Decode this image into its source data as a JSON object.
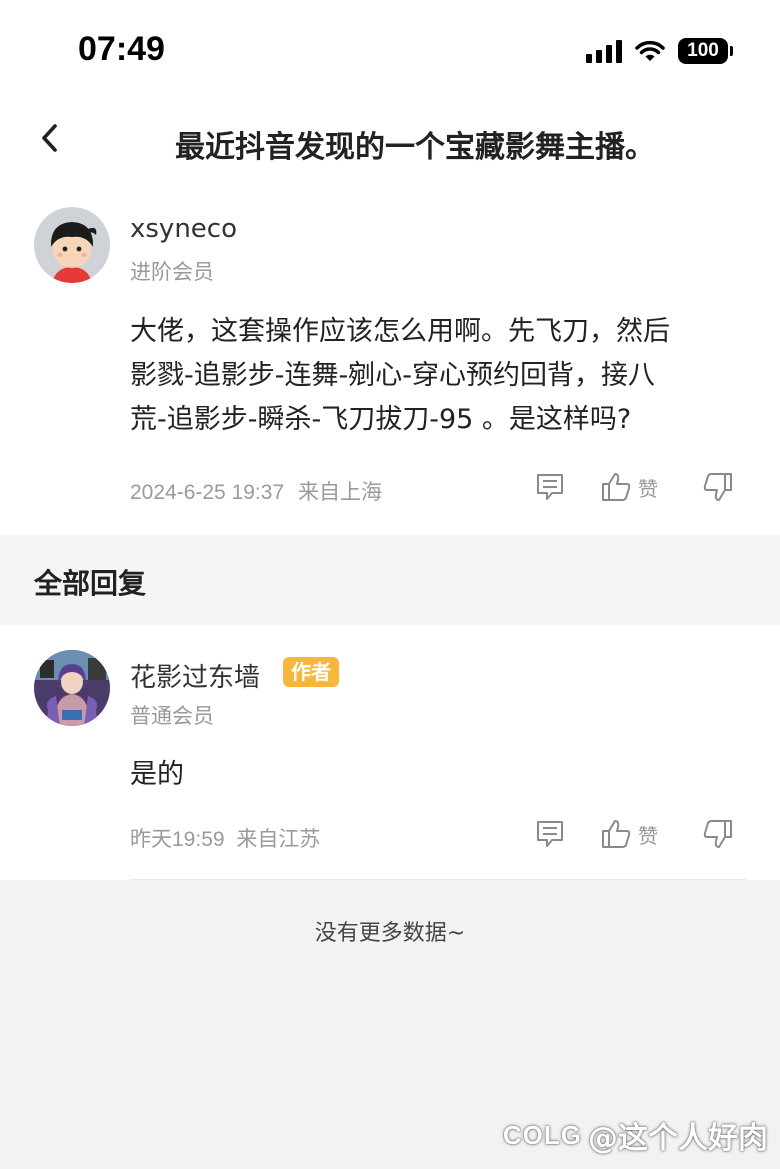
{
  "status_bar": {
    "time": "07:49",
    "battery": "100",
    "icons": [
      "signal-icon",
      "wifi-icon",
      "battery-icon"
    ]
  },
  "nav": {
    "title": "最近抖音发现的一个宝藏影舞主播。",
    "back_icon": "chevron-left-icon"
  },
  "main_comment": {
    "username": "xsyneco",
    "member_level": "进阶会员",
    "text_lines": [
      "大佬，这套操作应该怎么用啊。先飞刀，然后",
      "影戮-追影步-连舞-剜心-穿心预约回背，接八",
      "荒-追影步-瞬杀-飞刀拔刀-95 。是这样吗?"
    ],
    "date": "2024-6-25 19:37",
    "location": "来自上海",
    "like_label": "赞"
  },
  "section": {
    "title": "全部回复"
  },
  "reply": {
    "username": "花影过东墙",
    "badge": "作者",
    "member_level": "普通会员",
    "text": "是的",
    "date": "昨天19:59",
    "location": "来自江苏",
    "like_label": "赞"
  },
  "footer": {
    "no_more": "没有更多数据~"
  },
  "watermark": {
    "logo": "COLG",
    "text": "@这个人好肉"
  },
  "colors": {
    "badge": "#f6b73c",
    "section_bg": "#f5f5f5",
    "page_bg": "#f2f2f2"
  }
}
